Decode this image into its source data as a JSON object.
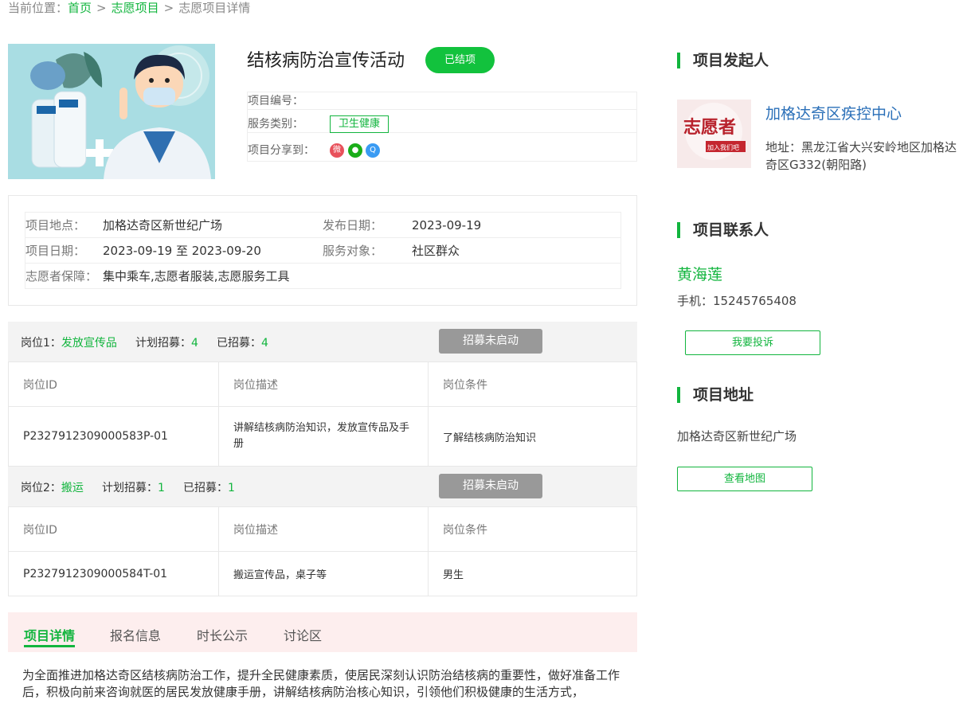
{
  "breadcrumb": {
    "prefix": "当前位置：",
    "home": "首页",
    "section": "志愿项目",
    "current": "志愿项目详情",
    "separator": ">"
  },
  "project": {
    "title": "结核病防治宣传活动",
    "status": "已结项",
    "number_label": "项目编号：",
    "number_value": "",
    "category_label": "服务类别：",
    "category_value": "卫生健康",
    "share_label": "项目分享到：",
    "share_icons": [
      "weibo-icon",
      "wechat-icon",
      "qq-icon"
    ]
  },
  "info": {
    "location_label": "项目地点：",
    "location_value": "加格达奇区新世纪广场",
    "publish_label": "发布日期：",
    "publish_value": "2023-09-19",
    "date_label": "项目日期：",
    "date_value": "2023-09-19 至 2023-09-20",
    "target_label": "服务对象：",
    "target_value": "社区群众",
    "guarantee_label": "志愿者保障：",
    "guarantee_value": "集中乘车,志愿者服装,志愿服务工具"
  },
  "positions": [
    {
      "prefix": "岗位1：",
      "name": "发放宣传品",
      "plan_label": "计划招募：",
      "plan_value": "4",
      "recruited_label": "已招募：",
      "recruited_value": "4",
      "button": "招募未启动",
      "headers": [
        "岗位ID",
        "岗位描述",
        "岗位条件"
      ],
      "row": [
        "P2327912309000583P-01",
        "讲解结核病防治知识，发放宣传品及手册",
        "了解结核病防治知识"
      ]
    },
    {
      "prefix": "岗位2：",
      "name": "搬运",
      "plan_label": "计划招募：",
      "plan_value": "1",
      "recruited_label": "已招募：",
      "recruited_value": "1",
      "button": "招募未启动",
      "headers": [
        "岗位ID",
        "岗位描述",
        "岗位条件"
      ],
      "row": [
        "P2327912309000584T-01",
        "搬运宣传品，桌子等",
        "男生"
      ]
    }
  ],
  "tabs": [
    "项目详情",
    "报名信息",
    "时长公示",
    "讨论区"
  ],
  "description": "为全面推进加格达奇区结核病防治工作，提升全民健康素质，使居民深刻认识防治结核病的重要性，做好准备工作后，积极向前来咨询就医的居民发放健康手册，讲解结核病防治核心知识，引领他们积极健康的生活方式，",
  "sidebar": {
    "initiator_title": "项目发起人",
    "org_name": "加格达奇区疾控中心",
    "org_address": "地址：黑龙江省大兴安岭地区加格达奇区G332(朝阳路)",
    "org_logo_text": "志愿者",
    "org_logo_subtext": "加入我们吧",
    "contact_title": "项目联系人",
    "contact_name": "黄海莲",
    "contact_phone": "手机：15245765408",
    "complain_button": "我要投诉",
    "address_title": "项目地址",
    "address_value": "加格达奇区新世纪广场",
    "map_button": "查看地图"
  },
  "colors": {
    "accent": "#12b53e",
    "badge": "#12c23d",
    "link_blue": "#2a6fb8",
    "tab_bg": "#fdeeee",
    "disabled_button": "#999999"
  }
}
